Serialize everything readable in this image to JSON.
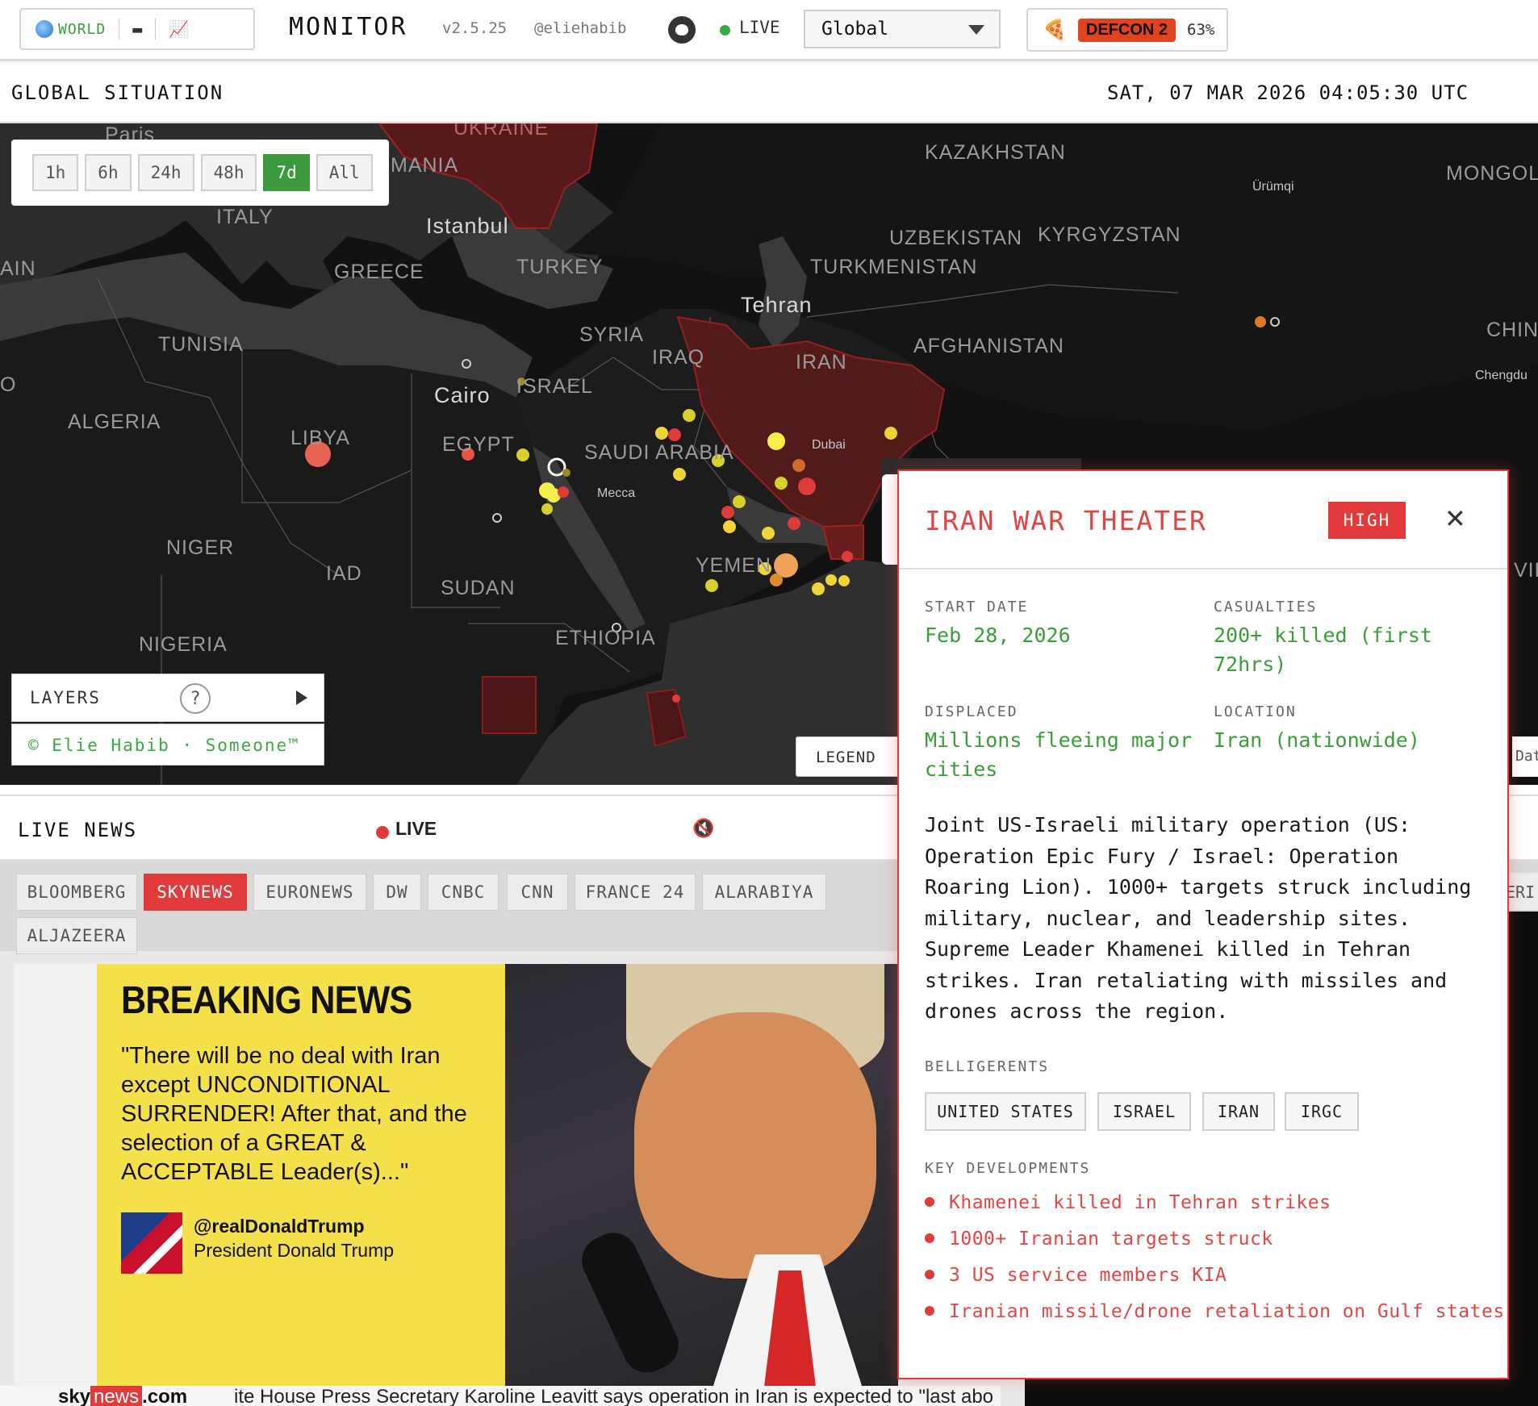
{
  "topbar": {
    "mode_world": "WORLD",
    "title": "MONITOR",
    "version": "v2.5.25",
    "handle": "@eliehabib",
    "live_label": "LIVE",
    "region_value": "Global",
    "defcon_label": "DEFCON 2",
    "defcon_percent": "63%"
  },
  "situation": {
    "title": "GLOBAL SITUATION",
    "datetime": "SAT, 07 MAR 2026 04:05:30 UTC"
  },
  "map": {
    "time_filters": [
      "1h",
      "6h",
      "24h",
      "48h",
      "7d",
      "All"
    ],
    "active_filter": "7d",
    "layers_label": "LAYERS",
    "help": "?",
    "credit": "© Elie Habib · Someone™",
    "legend_label": "LEGEND",
    "edge_text": "Dat",
    "labels": {
      "paris": "Paris",
      "ukraine": "UKRAINE",
      "romania": "MANIA",
      "kazakhstan": "KAZAKHSTAN",
      "mongolia": "MONGOL",
      "urumqi": "Ürümqi",
      "italy": "ITALY",
      "istanbul": "Istanbul",
      "uzbekistan": "UZBEKISTAN",
      "kyrgyzstan": "KYRGYZSTAN",
      "spain": "AIN",
      "greece": "GREECE",
      "turkey": "TURKEY",
      "turkmenistan": "TURKMENISTAN",
      "tehran": "Tehran",
      "china": "CHIN",
      "tunisia": "TUNISIA",
      "syria": "SYRIA",
      "iraq": "IRAQ",
      "iran": "IRAN",
      "afghanistan": "AFGHANISTAN",
      "chengdu": "Chengdu",
      "morocco": "O",
      "israel": "ISRAEL",
      "cairo": "Cairo",
      "algeria": "ALGERIA",
      "libya": "LIBYA",
      "egypt": "EGYPT",
      "saudi": "SAUDI ARABIA",
      "dubai": "Dubai",
      "mecca": "Mecca",
      "niger": "NIGER",
      "chad": "IAD",
      "yemen": "YEMEN",
      "sudan": "SUDAN",
      "vietnam": "VIE",
      "ethiopia": "ETHIOPIA",
      "nigeria": "NIGERIA"
    }
  },
  "live_news": {
    "title": "LIVE NEWS",
    "live_label": "LIVE",
    "channels": [
      "BLOOMBERG",
      "SKYNEWS",
      "EURONEWS",
      "DW",
      "CNBC",
      "CNN",
      "FRANCE 24",
      "ALARABIYA",
      "ALJAZEERA"
    ],
    "active_channel": "SKYNEWS",
    "edge_tab": "ERI",
    "video": {
      "headline": "BREAKING NEWS",
      "quote": "\"There will be no deal with Iran except UNCONDITIONAL SURRENDER! After that, and the selection of a GREAT & ACCEPTABLE Leader(s)...\"",
      "tw_handle": "@realDonaldTrump",
      "tw_name": "President Donald Trump",
      "ticker_logo_pre": "sky",
      "ticker_logo_mid": "news",
      "ticker_logo_post": ".com",
      "ticker_text": "ite House Press Secretary Karoline Leavitt says operation in Iran is expected to \"last abo"
    }
  },
  "popup": {
    "title": "IRAN WAR THEATER",
    "severity": "HIGH",
    "start_label": "START DATE",
    "start_value": "Feb 28, 2026",
    "casualties_label": "CASUALTIES",
    "casualties_value": "200+ killed (first 72hrs)",
    "displaced_label": "DISPLACED",
    "displaced_value": "Millions fleeing major cities",
    "location_label": "LOCATION",
    "location_value": "Iran (nationwide)",
    "description": "Joint US-Israeli military operation (US: Operation Epic Fury / Israel: Operation Roaring Lion). 1000+ targets struck including military, nuclear, and leadership sites. Supreme Leader Khamenei killed in Tehran strikes. Iran retaliating with missiles and drones across the region.",
    "belligerents_label": "BELLIGERENTS",
    "belligerents": [
      "UNITED STATES",
      "ISRAEL",
      "IRAN",
      "IRGC"
    ],
    "developments_label": "KEY DEVELOPMENTS",
    "developments": [
      "Khamenei killed in Tehran strikes",
      "1000+ Iranian targets struck",
      "3 US service members KIA",
      "Iranian missile/drone retaliation on Gulf states"
    ]
  },
  "colors": {
    "accent_green": "#3a9d3a",
    "alert_red": "#e23a3a",
    "defcon_orange": "#e2431c",
    "map_bg": "#121212",
    "breaking_yellow": "#f3e04a"
  },
  "icons": [
    "globe-icon",
    "monitor-icon",
    "chart-icon",
    "github-icon",
    "pizza-icon",
    "mute-icon",
    "close-icon",
    "play-icon",
    "help-icon"
  ]
}
